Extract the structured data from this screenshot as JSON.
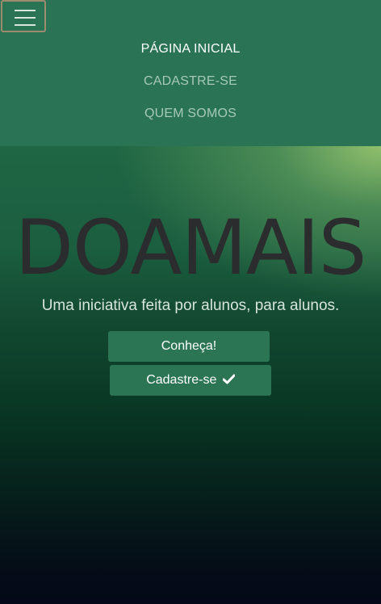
{
  "navbar": {
    "toggler_icon": "hamburger-menu-icon",
    "items": [
      {
        "label": "PÁGINA INICIAL",
        "active": true
      },
      {
        "label": "CADASTRE-SE",
        "active": false
      },
      {
        "label": "QUEM SOMOS",
        "active": false
      }
    ]
  },
  "hero": {
    "title": "DOAMAIS",
    "tagline": "Uma iniciativa feita por alunos, para alunos.",
    "buttons": {
      "conheca": "Conheça!",
      "cadastre": "Cadastre-se",
      "cadastre_icon": "check-icon"
    }
  },
  "colors": {
    "navbar_bg": "#2a7455",
    "button_bg": "#2b7554",
    "title_color": "#2a2c2d",
    "toggler_border": "#9c8b6d"
  }
}
